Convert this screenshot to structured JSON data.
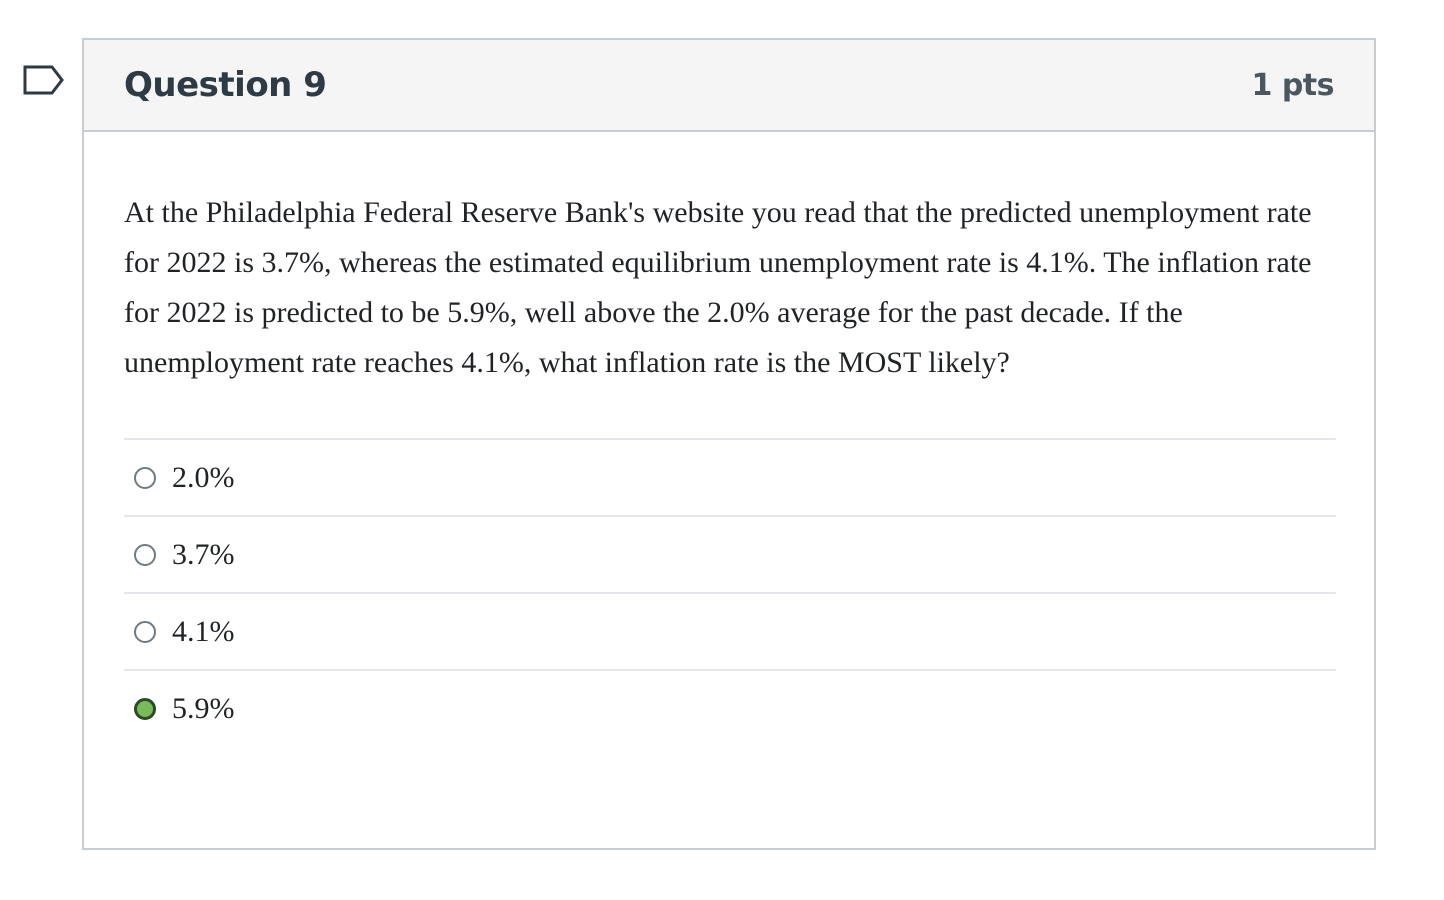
{
  "question": {
    "title": "Question 9",
    "points": "1 pts",
    "text": "At the Philadelphia Federal Reserve Bank's website you read that the predicted unemployment rate for 2022 is 3.7%, whereas the estimated equilibrium unemployment rate is 4.1%. The inflation rate for 2022 is predicted to be 5.9%, well above the 2.0% average for the past decade. If the unemployment rate reaches 4.1%, what inflation rate is the MOST likely?"
  },
  "answers": [
    {
      "label": "2.0%",
      "selected": false
    },
    {
      "label": "3.7%",
      "selected": false
    },
    {
      "label": "4.1%",
      "selected": false
    },
    {
      "label": "5.9%",
      "selected": true
    }
  ],
  "flag_icon": "bookmark-flag-icon",
  "colors": {
    "selected_fill": "#79bb59",
    "header_bg": "#f5f5f5",
    "border": "#c7cdd1"
  }
}
